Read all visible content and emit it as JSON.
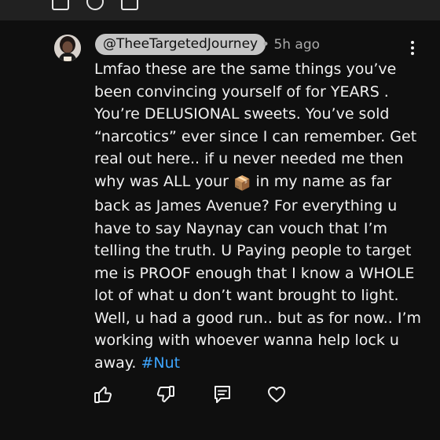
{
  "comment": {
    "author": "@TheeTargetedJourney",
    "separator": "•",
    "timestamp": "5h ago",
    "body_before_emoji": "Lmfao these are the same things you’ve been convincing yourself of for YEARS . You’re DELUSIONAL sweets. You’ve sold “narcotics” ever since I can remember. Get real out here.. if u never needed me then why was ALL your",
    "emoji": "📦",
    "body_after_emoji": "in my name as far back as James Avenue? For everything u have to say Naynay can vouch that I’m telling the truth. U Paying people to target me is PROOF enough that I know a WHOLE lot of what u don’t want brought to light. Well, u had a good run.. but as for now.. I’m working with whoever wanna help lock u away.",
    "hashtag": "#Nut"
  },
  "icons": {
    "menu": "more-vertical-icon",
    "like": "thumbs-up-icon",
    "dislike": "thumbs-down-icon",
    "reply": "reply-icon",
    "heart": "heart-icon"
  },
  "colors": {
    "background": "#0f0f0f",
    "text": "#f1f1f1",
    "secondary_text": "#aaaaaa",
    "handle_background": "#c5c5c5",
    "hashtag": "#3ea6ff"
  }
}
